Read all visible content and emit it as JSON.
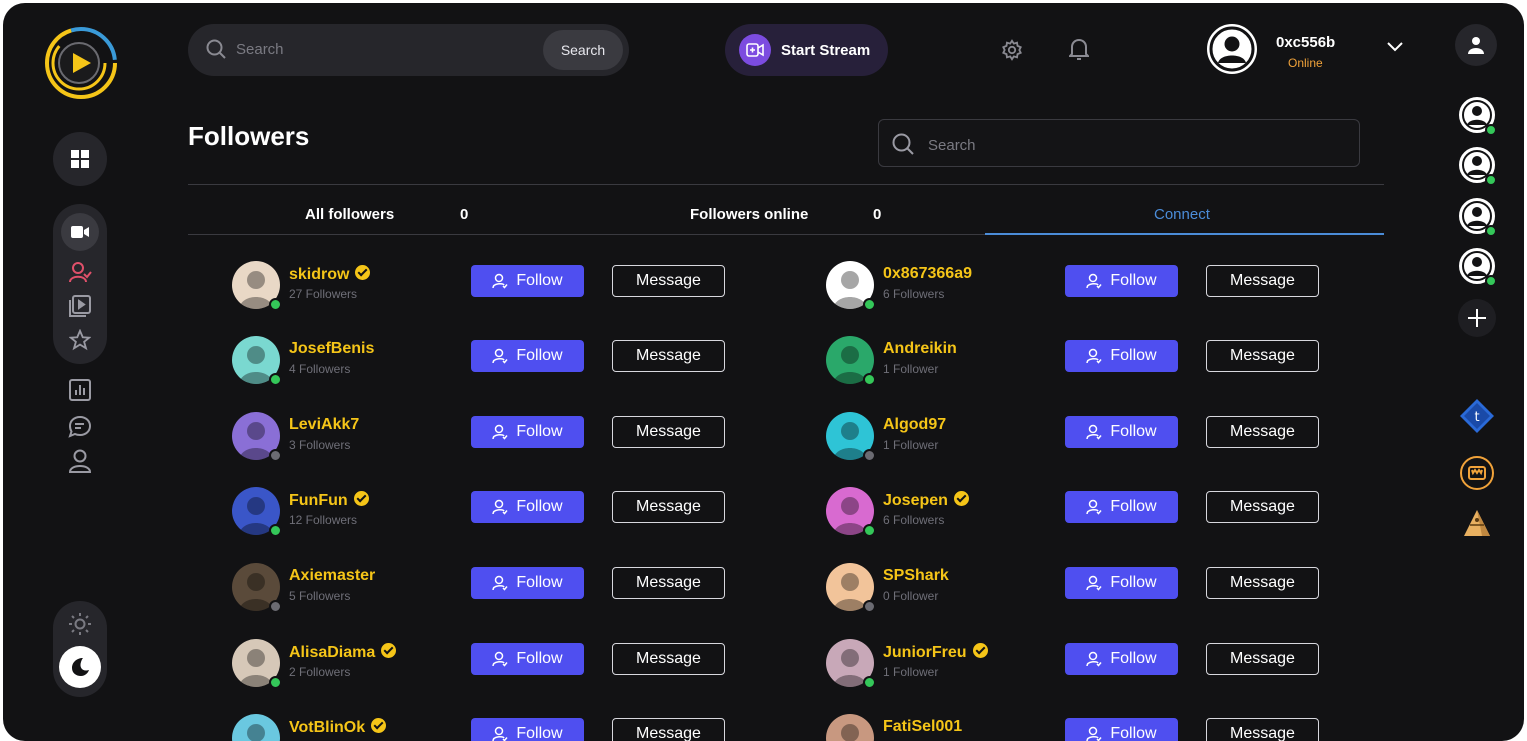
{
  "topbar": {
    "search_placeholder": "Search",
    "search_button": "Search",
    "start_stream": "Start Stream",
    "user_name": "0xc556b",
    "user_status": "Online"
  },
  "page": {
    "title": "Followers",
    "search_placeholder": "Search"
  },
  "tabs": {
    "all_label": "All followers",
    "all_count": "0",
    "online_label": "Followers online",
    "online_count": "0",
    "connect_label": "Connect"
  },
  "buttons": {
    "follow": "Follow",
    "message": "Message"
  },
  "colors": {
    "accent": "#4f4ff0",
    "name": "#f5c518",
    "online": "#34c759",
    "offline": "#6b6b72",
    "connect": "#4b8cd8"
  },
  "followers": [
    {
      "name": "skidrow",
      "count": "27 Followers",
      "verified": true,
      "online": true,
      "av": "#e9d8c6"
    },
    {
      "name": "0x867366a9",
      "count": "6 Followers",
      "verified": false,
      "online": true,
      "av": "#ffffff"
    },
    {
      "name": "JosefBenis",
      "count": "4 Followers",
      "verified": false,
      "online": true,
      "av": "#7ad8d0"
    },
    {
      "name": "Andreikin",
      "count": "1 Follower",
      "verified": false,
      "online": true,
      "av": "#2aa86a"
    },
    {
      "name": "LeviAkk7",
      "count": "3 Followers",
      "verified": false,
      "online": false,
      "av": "#8a6fd6"
    },
    {
      "name": "Algod97",
      "count": "1 Follower",
      "verified": false,
      "online": false,
      "av": "#2ec4d6"
    },
    {
      "name": "FunFun",
      "count": "12 Followers",
      "verified": true,
      "online": true,
      "av": "#3a56c8"
    },
    {
      "name": "Josepen",
      "count": "6 Followers",
      "verified": true,
      "online": true,
      "av": "#d86ad0"
    },
    {
      "name": "Axiemaster",
      "count": "5 Followers",
      "verified": false,
      "online": false,
      "av": "#5a4a3a"
    },
    {
      "name": "SPShark",
      "count": "0 Follower",
      "verified": false,
      "online": false,
      "av": "#f2c49a"
    },
    {
      "name": "AlisaDiama",
      "count": "2 Followers",
      "verified": true,
      "online": true,
      "av": "#d6c8b8"
    },
    {
      "name": "JuniorFreu",
      "count": "1 Follower",
      "verified": true,
      "online": true,
      "av": "#c8a8b8"
    },
    {
      "name": "VotBlinOk",
      "count": "",
      "verified": true,
      "online": true,
      "av": "#6ac8e0"
    },
    {
      "name": "FatiSel001",
      "count": "",
      "verified": false,
      "online": true,
      "av": "#c89880"
    }
  ]
}
